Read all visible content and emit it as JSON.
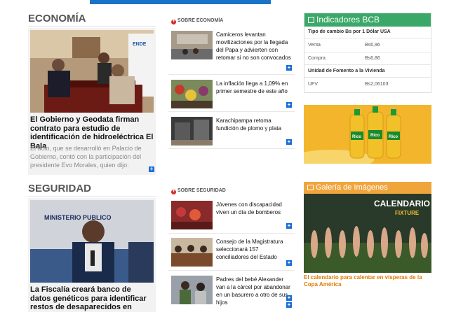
{
  "economia": {
    "section_title": "ECONOMÍA",
    "lead": {
      "title": "El Gobierno y Geodata firman contrato para estudio de identificación de hidroeléctrica El Bala",
      "excerpt": "El acto, que se desarrolló en Palacio de Gobierno, contó con la participación del presidente Evo Morales, quien dijo: \"Escuchamos que una de las..."
    },
    "sub_heading": "SOBRE ECONOMÍA",
    "items": [
      {
        "text": "Camiceros levantan movilizaciones por la llegada del Papa y advierten con retomar si no son convocados"
      },
      {
        "text": "La inflación llega a 1,09% en primer semestre de este año"
      },
      {
        "text": "Karachipampa retoma fundición de plomo y plata"
      }
    ]
  },
  "seguridad": {
    "section_title": "SEGURIDAD",
    "lead": {
      "title": "La Fiscalía creará banco de datos genéticos para identificar restos de desaparecidos en dictaduras",
      "photo_text": "MINISTERIO PUBLICO"
    },
    "sub_heading": "SOBRE SEGURIDAD",
    "items": [
      {
        "text": "Jóvenes con discapacidad viven un día de bomberos"
      },
      {
        "text": "Consejo de la Magistratura seleccionará 157 conciliadores del Estado"
      },
      {
        "text": "Padres del bebé Alexander van a la cárcel por abandonar en un basurero a otro de sus hijos"
      }
    ]
  },
  "bcb": {
    "title": "Indicadores BCB",
    "exchange_label": "Tipo de cambio Bs por 1 Dólar USA",
    "rows": [
      {
        "label": "Venta",
        "value": "Bs6,96"
      },
      {
        "label": "Compra",
        "value": "Bs6,86"
      }
    ],
    "ufv_label": "Unidad de Fomento a la Vivienda",
    "ufv": {
      "label": "UFV",
      "value": "Bs2,06103"
    }
  },
  "ad": {
    "brand": "Rico"
  },
  "galeria": {
    "title": "Galería de Imágenes",
    "image_title": "CALENDARIO",
    "image_subtitle": "FIXTURE",
    "caption": "El calendario para calentar en vísperas de la Copa América"
  },
  "more_symbol": "+",
  "colors": {
    "bcb_green": "#3aa868",
    "gallery_orange": "#f0a53c",
    "link_blue": "#1a6fd6",
    "dot_red": "#d72b2b"
  }
}
